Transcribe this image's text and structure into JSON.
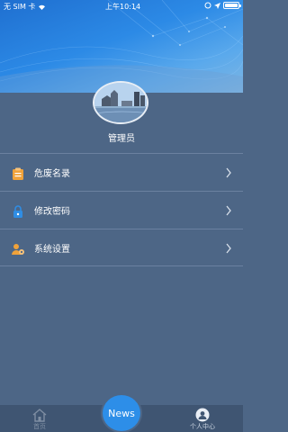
{
  "status_bar": {
    "carrier": "无 SIM 卡",
    "wifi_icon": "wifi-icon",
    "time": "上午10:14",
    "right_icons": [
      "lock-rotation-icon",
      "location-arrow-icon",
      "battery-icon"
    ]
  },
  "profile": {
    "avatar_icon": "city-skyline-avatar",
    "name": "管理员"
  },
  "menu": {
    "items": [
      {
        "label": "危废名录",
        "icon": "clipboard-icon",
        "icon_color": "#f0a23a"
      },
      {
        "label": "修改密码",
        "icon": "lock-icon",
        "icon_color": "#2f8de4"
      },
      {
        "label": "系统设置",
        "icon": "user-gear-icon",
        "icon_color": "#f0a23a"
      }
    ]
  },
  "tabbar": {
    "home_label": "首页",
    "news_label": "News",
    "me_label": "个人中心"
  },
  "colors": {
    "background": "#4d6686",
    "header_blue": "#2c8ae6",
    "tabbar": "#3f5572",
    "news_button": "#2d8ee8"
  }
}
